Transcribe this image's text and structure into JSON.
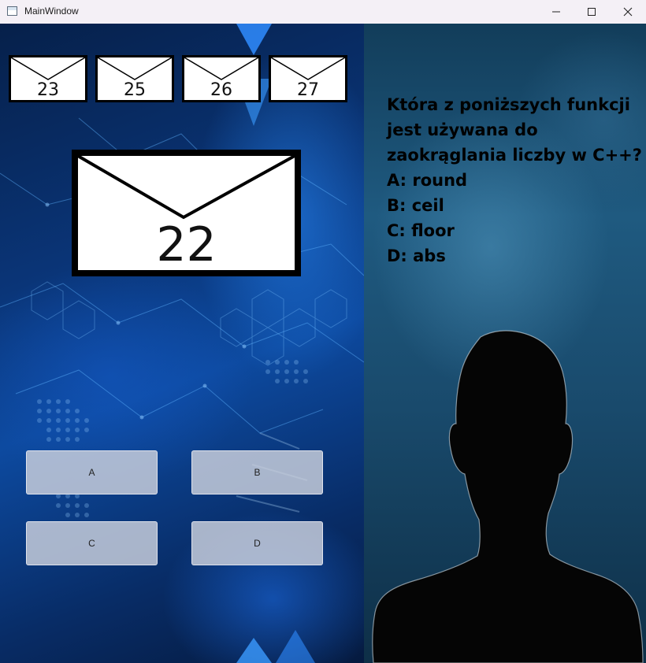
{
  "window": {
    "title": "MainWindow"
  },
  "envelopes": {
    "upcoming": [
      "23",
      "25",
      "26",
      "27"
    ],
    "current": "22"
  },
  "question": {
    "lines": [
      "Która z poniższych funkcji",
      "jest używana do",
      "zaokrąglania liczby w C++?"
    ],
    "options": [
      "A: round",
      "B: ceil",
      "C: floor",
      "D: abs"
    ]
  },
  "answer_buttons": {
    "a": "A",
    "b": "B",
    "c": "C",
    "d": "D"
  },
  "icons": {
    "app": "window-app-icon",
    "minimize": "minimize-icon",
    "maximize": "maximize-icon",
    "close": "close-icon"
  }
}
